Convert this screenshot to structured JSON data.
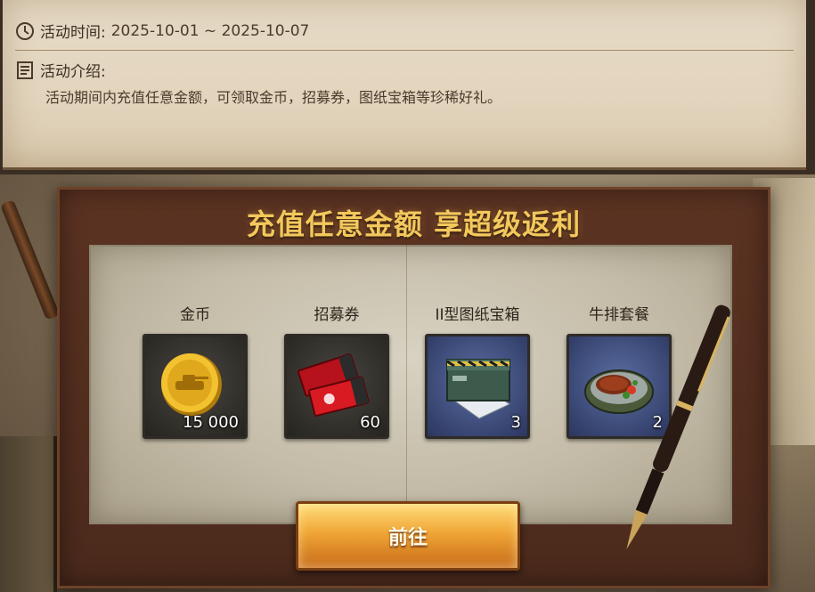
{
  "event": {
    "time_label": "活动时间:",
    "time_value": "2025-10-01 ~ 2025-10-07",
    "intro_label": "活动介绍:",
    "intro_text": "活动期间内充值任意金额，可领取金币，招募券，图纸宝箱等珍稀好礼。"
  },
  "promo": {
    "headline": "充值任意金额 享超级返利",
    "button_label": "前往",
    "rewards": [
      {
        "name": "金币",
        "quantity": "15 000",
        "icon": "gold-coin-icon"
      },
      {
        "name": "招募券",
        "quantity": "60",
        "icon": "recruit-ticket-icon"
      },
      {
        "name": "II型图纸宝箱",
        "quantity": "3",
        "icon": "blueprint-crate-icon"
      },
      {
        "name": "牛排套餐",
        "quantity": "2",
        "icon": "steak-meal-icon"
      }
    ]
  },
  "colors": {
    "headline": "#f3c85c",
    "button": "#f0a636",
    "panel": "#e2d4bd"
  }
}
